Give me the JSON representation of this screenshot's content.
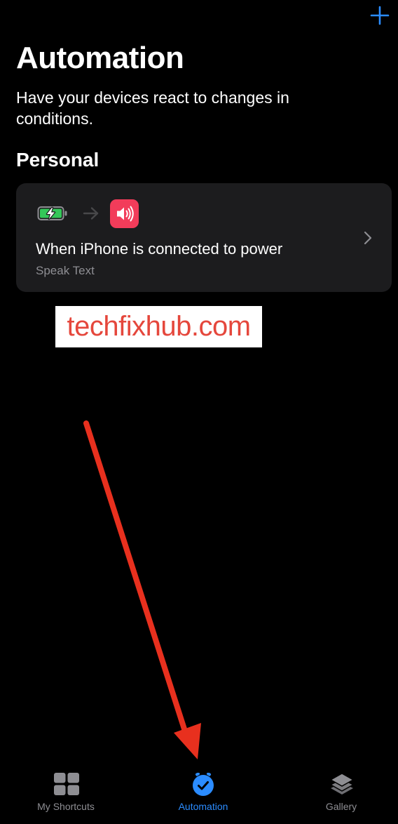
{
  "header": {
    "title": "Automation",
    "subtitle": "Have your devices react to changes in conditions.",
    "add_icon": "plus-icon"
  },
  "section": {
    "title": "Personal"
  },
  "automation_card": {
    "title": "When iPhone is connected to power",
    "action": "Speak Text",
    "trigger_icon": "battery-charging-icon",
    "action_icon": "speaker-icon",
    "action_color": "#f23c5a"
  },
  "watermark": {
    "text": "techfixhub.com",
    "color": "#e5473c"
  },
  "tabbar": {
    "tabs": [
      {
        "label": "My Shortcuts",
        "icon": "grid-icon",
        "active": false
      },
      {
        "label": "Automation",
        "icon": "clock-check-icon",
        "active": true
      },
      {
        "label": "Gallery",
        "icon": "layers-icon",
        "active": false
      }
    ],
    "accent": "#2b8cff"
  }
}
